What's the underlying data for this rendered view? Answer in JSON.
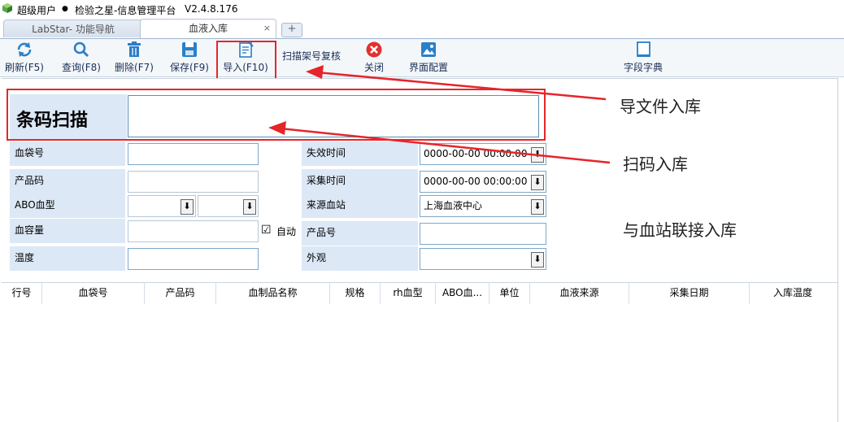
{
  "title_bar": {
    "user": "超级用户",
    "separator": "●",
    "app": "检验之星-信息管理平台",
    "version": "V2.4.8.176"
  },
  "tabs": [
    {
      "label": "LabStar- 功能导航",
      "active": false
    },
    {
      "label": "血液入库",
      "active": true,
      "close": "×"
    }
  ],
  "tab_add": "+",
  "toolbar": {
    "refresh": "刷新(F5)",
    "query": "查询(F8)",
    "delete": "删除(F7)",
    "save": "保存(F9)",
    "import": "导入(F10)",
    "scan_recheck": "扫描架号复核",
    "close": "关闭",
    "ui_config": "界面配置",
    "field_dict": "字段字典"
  },
  "form": {
    "barcode_label": "条码扫描",
    "barcode_value": "",
    "bag_no_label": "血袋号",
    "bag_no_value": "",
    "product_code_label": "产品码",
    "product_code_value": "",
    "abo_label": "ABO血型",
    "abo_value_1": "",
    "abo_value_2": "",
    "volume_label": "血容量",
    "volume_value": "",
    "auto_label": "自动",
    "auto_checked": "☑",
    "temperature_label": "温度",
    "temperature_value": "",
    "expire_label": "失效时间",
    "expire_value": "0000-00-00 00:00:00",
    "collect_label": "采集时间",
    "collect_value": "0000-00-00 00:00:00",
    "source_label": "来源血站",
    "source_value": "上海血液中心",
    "product_no_label": "产品号",
    "product_no_value": "",
    "appearance_label": "外观",
    "appearance_value": "",
    "dropdown_glyph": "⬇"
  },
  "grid": {
    "columns": [
      "行号",
      "血袋号",
      "产品码",
      "血制品名称",
      "规格",
      "rh血型",
      "ABO血...",
      "单位",
      "血液来源",
      "采集日期",
      "入库温度"
    ]
  },
  "annotations": {
    "import_note": "导文件入库",
    "scan_note": "扫码入库",
    "link_note": "与血站联接入库",
    "color": "#e5252a"
  }
}
